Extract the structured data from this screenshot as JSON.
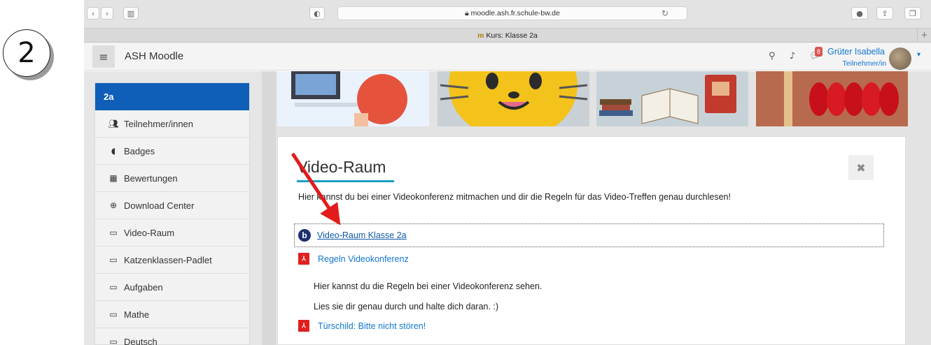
{
  "step_number": "2",
  "browser": {
    "url": "moodle.ash.fr.schule-bw.de",
    "tab_title": "Kurs: Klasse 2a"
  },
  "navbar": {
    "brand": "ASH Moodle",
    "message_count": "8",
    "user_name": "Grüter Isabella",
    "user_role": "Teilnehmer/in"
  },
  "drawer": {
    "items": [
      {
        "label": "2a",
        "icon": "course-home",
        "active": true
      },
      {
        "label": "Teilnehmer/innen",
        "icon": "users-icon"
      },
      {
        "label": "Badges",
        "icon": "shield-icon"
      },
      {
        "label": "Bewertungen",
        "icon": "table-icon"
      },
      {
        "label": "Download Center",
        "icon": "download-icon"
      },
      {
        "label": "Video-Raum",
        "icon": "folder-icon"
      },
      {
        "label": "Katzenklassen-Padlet",
        "icon": "folder-icon"
      },
      {
        "label": "Aufgaben",
        "icon": "folder-icon"
      },
      {
        "label": "Mathe",
        "icon": "folder-icon"
      },
      {
        "label": "Deutsch",
        "icon": "folder-icon"
      }
    ]
  },
  "section": {
    "title": "Video-Raum",
    "intro": "Hier kannst du bei einer Videokonferenz mitmachen und dir die Regeln für das Video-Treffen genau durchlesen!",
    "activities": [
      {
        "label": "Video-Raum Klasse 2a",
        "icon": "bigbluebutton-icon"
      },
      {
        "label": "Regeln Videokonferenz",
        "icon": "pdf-icon"
      },
      {
        "label": "Türschild: Bitte nicht stören!",
        "icon": "pdf-icon"
      }
    ],
    "description_lines": [
      "Hier kannst du die Regeln bei einer Videokonferenz sehen.",
      "Lies sie dir genau durch und halte dich daran. :)"
    ]
  },
  "colors": {
    "drawer_active": "#0f5fb8",
    "link": "#1177d1",
    "title_underline": "#1aa0c8",
    "annotation_arrow": "#e21b1b"
  }
}
